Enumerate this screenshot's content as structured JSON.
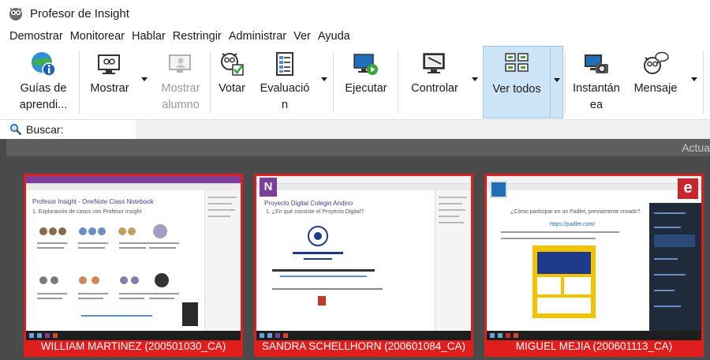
{
  "window": {
    "title": "Profesor de Insight",
    "icon": "insight-owl-icon"
  },
  "menu": [
    "Demostrar",
    "Monitorear",
    "Hablar",
    "Restringir",
    "Administrar",
    "Ver",
    "Ayuda"
  ],
  "ribbon": {
    "guides": {
      "line1": "Guías de",
      "line2": "aprendi...",
      "icon": "globe-info-icon"
    },
    "show": {
      "line1": "Mostrar",
      "icon": "owl-monitor-icon"
    },
    "show_student": {
      "line1": "Mostrar",
      "line2": "alumno",
      "icon": "student-monitor-icon",
      "enabled": false
    },
    "vote": {
      "line1": "Votar",
      "icon": "owl-check-icon"
    },
    "evaluation": {
      "line1": "Evaluació",
      "line2": "n",
      "icon": "clipboard-list-icon"
    },
    "execute": {
      "line1": "Ejecutar",
      "icon": "monitor-run-icon"
    },
    "control": {
      "line1": "Controlar",
      "icon": "monitor-mouse-icon"
    },
    "view_all": {
      "line1": "Ver todos",
      "icon": "monitor-grid-icon",
      "active": true
    },
    "snapshot": {
      "line1": "Instantán",
      "line2": "ea",
      "icon": "camera-monitor-icon"
    },
    "message": {
      "line1": "Mensaje",
      "icon": "owl-speech-icon"
    }
  },
  "search": {
    "label": "Buscar:",
    "value": ""
  },
  "header": {
    "text": "Actua"
  },
  "students": [
    {
      "name": "WILLIAM MARTINEZ (200501030_CA)",
      "app": "onenote",
      "heading": "Profesor Insight - OneNote Class Notebook",
      "sub": "1. Exploración de casos con Profesor Insight"
    },
    {
      "name": "SANDRA SCHELLHORN (200601084_CA)",
      "app": "onenote",
      "heading": "Proyecto Digital Colegio Andino",
      "sub": "1. ¿En qué consiste el Proyecto Digital?",
      "badge": "N"
    },
    {
      "name": "MIGUEL MEJIA (200601113_CA)",
      "app": "edge",
      "heading": "¿Cómo participar en un Padlet, previamente creado?",
      "sub": "https://padlet.com/",
      "badge": "e"
    }
  ],
  "colors": {
    "tile_border": "#e01e1e",
    "active_button": "#cde4f7",
    "main_background": "#4a4a4a",
    "onenote_purple": "#7b3e9c",
    "edge_red": "#c9252c"
  }
}
